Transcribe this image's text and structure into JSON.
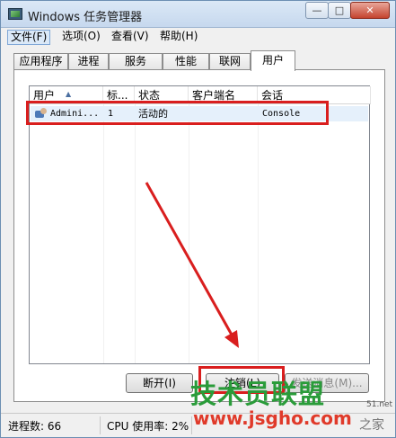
{
  "window": {
    "title": "Windows 任务管理器"
  },
  "title_buttons": {
    "minimize": "—",
    "maximize": "□",
    "close": "✕"
  },
  "menu": [
    {
      "label": "文件(F)"
    },
    {
      "label": "选项(O)"
    },
    {
      "label": "查看(V)"
    },
    {
      "label": "帮助(H)"
    }
  ],
  "tabs": [
    {
      "label": "应用程序"
    },
    {
      "label": "进程"
    },
    {
      "label": "服务"
    },
    {
      "label": "性能"
    },
    {
      "label": "联网"
    },
    {
      "label": "用户",
      "selected": true
    }
  ],
  "columns": [
    "用户",
    "标...",
    "状态",
    "客户端名",
    "会话"
  ],
  "rows": [
    {
      "user": "Admini...",
      "id": "1",
      "status": "活动的",
      "client": "",
      "session": "Console"
    }
  ],
  "buttons": {
    "disconnect": "断开(I)",
    "logoff": "注销(L)",
    "send_message": "发送消息(M)..."
  },
  "status": {
    "processes": "进程数: 66",
    "cpu": "CPU 使用率: 2%"
  },
  "watermark": {
    "main": "技术员联盟",
    "url": "www.jsgho.com",
    "side": "51.net",
    "side2": "之家"
  },
  "colors": {
    "highlight": "#d91e1e",
    "watermark_green": "#2a9c3a",
    "watermark_red": "#e03a2a"
  }
}
